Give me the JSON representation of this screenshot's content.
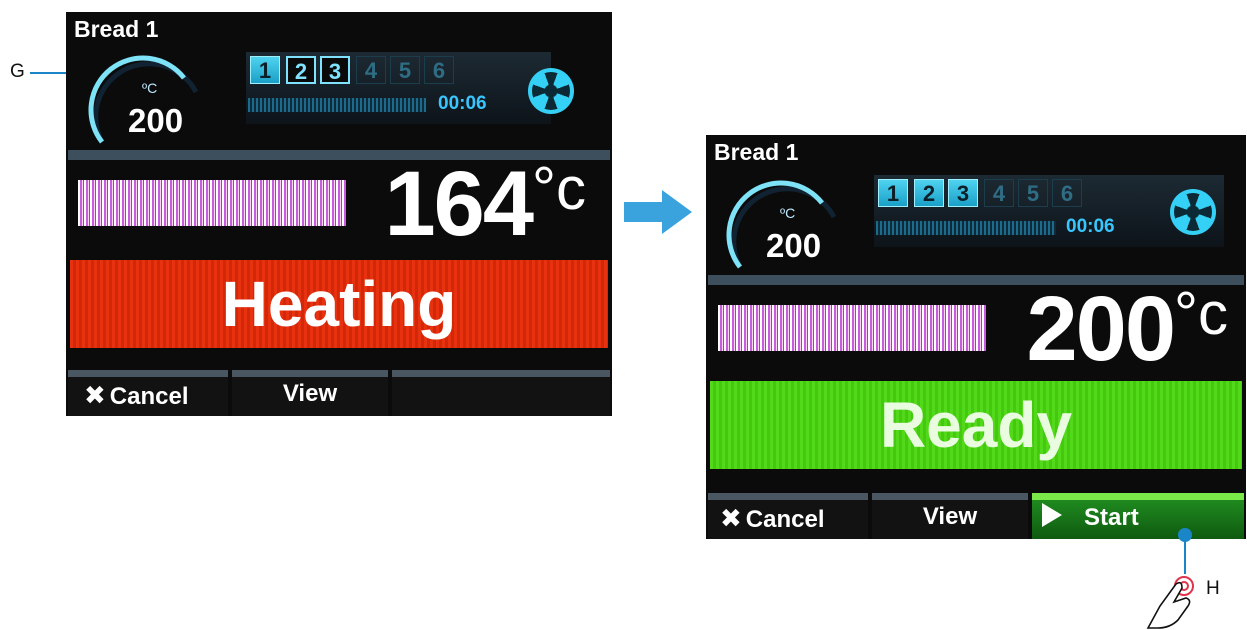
{
  "callouts": {
    "g": "G",
    "h": "H"
  },
  "screens": [
    {
      "program": "Bread 1",
      "setpoint_unit": "ºC",
      "setpoint": "200",
      "stages": [
        "1",
        "2",
        "3",
        "4",
        "5",
        "6"
      ],
      "timer": "00:06",
      "temperature": "164",
      "temp_unit": "°c",
      "status": "Heating",
      "softkeys": {
        "cancel": "Cancel",
        "view": "View",
        "third": ""
      },
      "colors": {
        "status_bg": "#e8310f"
      }
    },
    {
      "program": "Bread 1",
      "setpoint_unit": "ºC",
      "setpoint": "200",
      "stages": [
        "1",
        "2",
        "3",
        "4",
        "5",
        "6"
      ],
      "timer": "00:06",
      "temperature": "200",
      "temp_unit": "°c",
      "status": "Ready",
      "softkeys": {
        "cancel": "Cancel",
        "view": "View",
        "start": "Start"
      },
      "colors": {
        "status_bg": "#52d91a"
      }
    }
  ],
  "icons": [
    "fan-icon",
    "cancel-x-icon",
    "play-icon",
    "right-arrow-icon",
    "hand-press-icon"
  ]
}
